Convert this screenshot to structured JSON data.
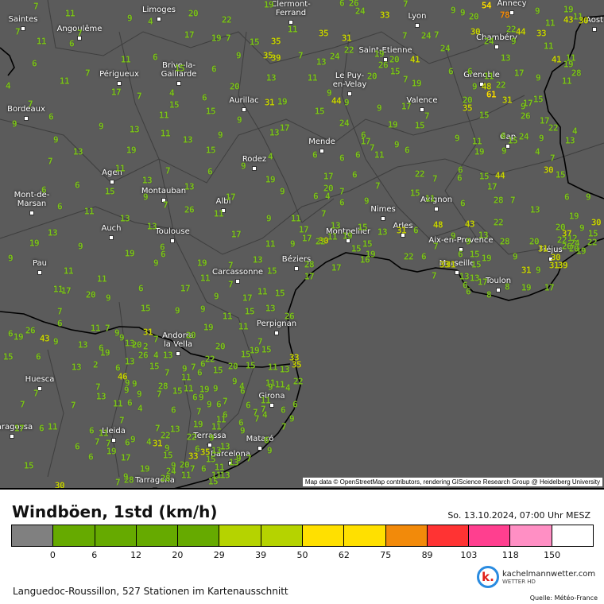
{
  "map": {
    "attribution": "Map data © OpenStreetMap contributors, rendering GIScience Research Group @ Heidelberg University",
    "cities": [
      "Saintes",
      "Angoulême",
      "Limoges",
      "Clermont-\nFerrand",
      "Lyon",
      "Annecy",
      "Aost",
      "Chambéry",
      "Saint-Etienne",
      "Le Puy-\nen-Velay",
      "Grenoble",
      "Valence",
      "Périgueux",
      "Brive-la-\nGaillarde",
      "Aurillac",
      "Bordeaux",
      "Gap",
      "Mende",
      "Rodez",
      "Agen",
      "Montauban",
      "Albi",
      "Avignon",
      "Nimes",
      "Arles",
      "Mont-de-\nMarsan",
      "Auch",
      "Toulouse",
      "Montpellier",
      "Aix-en-Provence",
      "Fréjus",
      "Pau",
      "Béziers",
      "Carcassonne",
      "Marseille",
      "Toulon",
      "Perpignan",
      "Andorra\nla Vella",
      "Girona",
      "Huesca",
      "Zaragossa",
      "Lleida",
      "Terrassa",
      "Mataró",
      "Barcelona",
      "Tarragona"
    ],
    "station_values": [
      7,
      11,
      9,
      4,
      20,
      22,
      19,
      11,
      7,
      7,
      11,
      6,
      17,
      19,
      7,
      15,
      35,
      6,
      11,
      6,
      9,
      35,
      39,
      7,
      7,
      15,
      6,
      13,
      4,
      11,
      17,
      7,
      4,
      20,
      6,
      7,
      6,
      9,
      15,
      15,
      31,
      19,
      11,
      9,
      9,
      13,
      11,
      13,
      9,
      13,
      17,
      9,
      13,
      19,
      15,
      4,
      9,
      7,
      11,
      7,
      6,
      19,
      6,
      13,
      13,
      15,
      9,
      7,
      26,
      17,
      11,
      9,
      6,
      6,
      11,
      13,
      13,
      17,
      11,
      9,
      13,
      19,
      9,
      9,
      19,
      6,
      6,
      9,
      19,
      7,
      13,
      11,
      9,
      15,
      11,
      11,
      11,
      17,
      20,
      9,
      6,
      17,
      11,
      7,
      9,
      17,
      11,
      15,
      7,
      15,
      9,
      9,
      11,
      15,
      13,
      26,
      6,
      11,
      7,
      19,
      11,
      6,
      19,
      26,
      43,
      9,
      13,
      9,
      31,
      7,
      20,
      20,
      19,
      7,
      15,
      15,
      15,
      6,
      6,
      19,
      9,
      13,
      20,
      2,
      26,
      4,
      13,
      2,
      13,
      13,
      15,
      7,
      22,
      6,
      9,
      7,
      11,
      6,
      20,
      15,
      15,
      11,
      33,
      35,
      6,
      46,
      11,
      19,
      9,
      9,
      13,
      11,
      7,
      9,
      9,
      28,
      15,
      7,
      7,
      13,
      9,
      9,
      4,
      6,
      9,
      11,
      4,
      22,
      7,
      7,
      11,
      6,
      4,
      7,
      6,
      9,
      9,
      6,
      7,
      6,
      11,
      6,
      6,
      7,
      7,
      6,
      7,
      4,
      6,
      11,
      9,
      17,
      6,
      11,
      7,
      6,
      11,
      7,
      13,
      19,
      11,
      6,
      9,
      7,
      7,
      7,
      6,
      9,
      4,
      31,
      22,
      22,
      6,
      9,
      13,
      13,
      6,
      9,
      7,
      6,
      19,
      17,
      6,
      9,
      15,
      33,
      35,
      15,
      11,
      13,
      9,
      15,
      19,
      9,
      20,
      7,
      6,
      28,
      24,
      11,
      11,
      13,
      7,
      28,
      30,
      9,
      15,
      6,
      26,
      24,
      7,
      33,
      9,
      9,
      20,
      54,
      78,
      9,
      19,
      43,
      11,
      30,
      11,
      35,
      31,
      7,
      24,
      7,
      30,
      22,
      44,
      33,
      9,
      24,
      11,
      24,
      22,
      13,
      19,
      26,
      20,
      41,
      24,
      13,
      41,
      11,
      19,
      28,
      11,
      20,
      15,
      7,
      19,
      6,
      6,
      11,
      9,
      48,
      22,
      17,
      9,
      11,
      9,
      44,
      9,
      9,
      17,
      20,
      35,
      61,
      31,
      9,
      17,
      15,
      15,
      24,
      19,
      15,
      7,
      15,
      26,
      17,
      22,
      4,
      13,
      6,
      17,
      7,
      11,
      9,
      6,
      6,
      6,
      6,
      9,
      11,
      19,
      6,
      15,
      24,
      9,
      4,
      7,
      9,
      17,
      6,
      7,
      20,
      7,
      6,
      4,
      22,
      7,
      6,
      6,
      15,
      44,
      17,
      30,
      15,
      6,
      9,
      9,
      6,
      7,
      15,
      11,
      6,
      28,
      7,
      13,
      19,
      17,
      13,
      15,
      13,
      31,
      6,
      11,
      48,
      43,
      22,
      20,
      37,
      9,
      15,
      30,
      30,
      17,
      22,
      15,
      15,
      19,
      9,
      13,
      9,
      28,
      20,
      31,
      22,
      12,
      19,
      20,
      26,
      24,
      22,
      19,
      16,
      22,
      6,
      7,
      6,
      15,
      19,
      9,
      31,
      33,
      15,
      30,
      39,
      31,
      28,
      17,
      17,
      7,
      13,
      13,
      31,
      9,
      6,
      6,
      17,
      8,
      19,
      17,
      8
    ]
  },
  "legend": {
    "title": "Windböen, 1std (km/h)",
    "datetime": "So. 13.10.2024, 07:00 Uhr MESZ",
    "colors": [
      "#808080",
      "#66aa00",
      "#66aa00",
      "#66aa00",
      "#66aa00",
      "#b5d300",
      "#b5d300",
      "#ffe000",
      "#ffe000",
      "#f28a0a",
      "#ff3333",
      "#ff3f8f",
      "#ff8fc4",
      "#ffffff"
    ],
    "ticks": [
      "0",
      "6",
      "12",
      "20",
      "29",
      "39",
      "50",
      "62",
      "75",
      "89",
      "103",
      "118",
      "150"
    ]
  },
  "footer": {
    "stations_text": "Languedoc-Roussillon, 527 Stationen im Kartenausschnitt",
    "brand": "kachelmannwetter.com",
    "brand_sub": "WETTER HD",
    "logo_letter": "k.",
    "source": "Quelle: Météo-France"
  }
}
